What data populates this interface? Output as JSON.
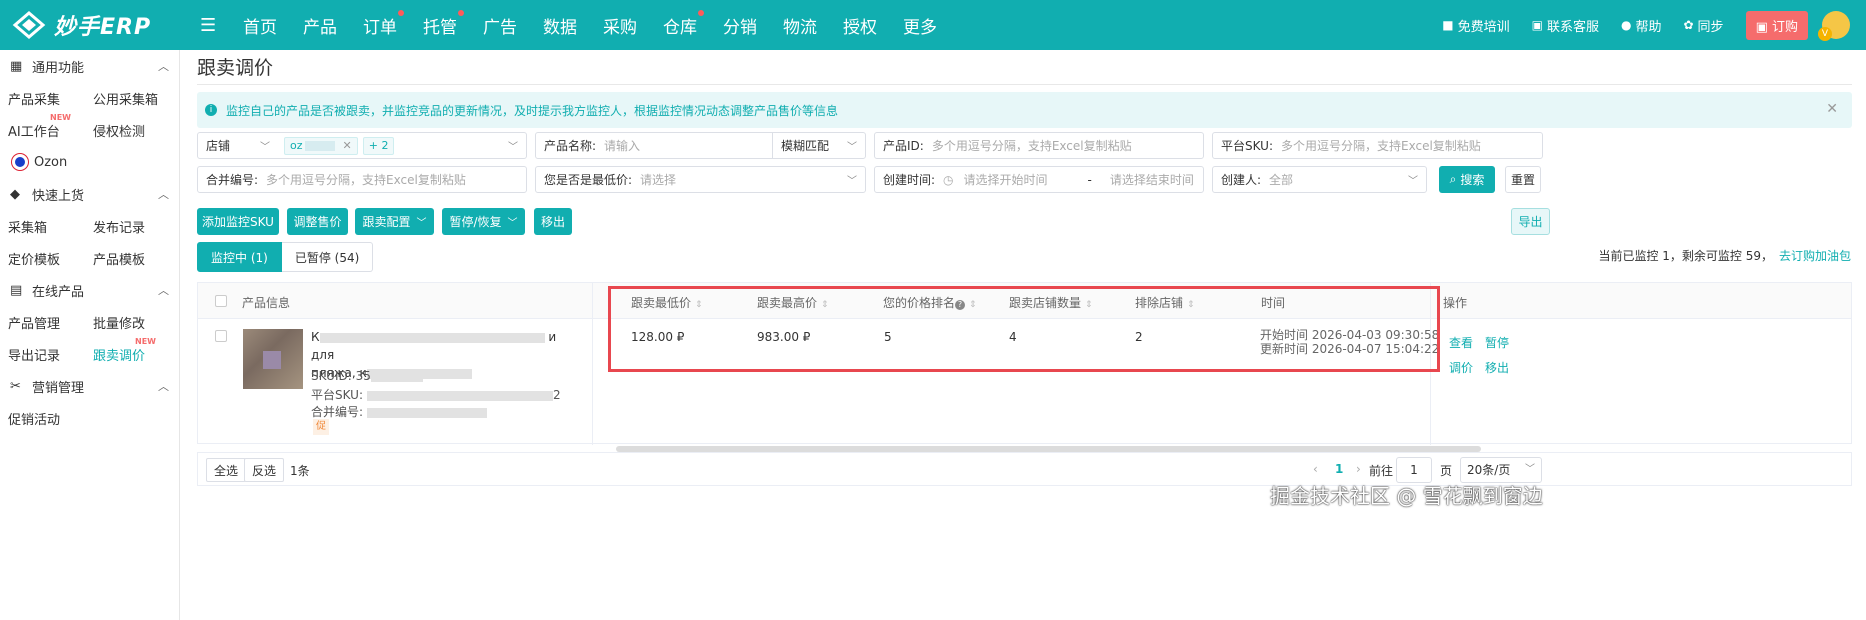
{
  "app": {
    "name": "妙手ERP"
  },
  "topnav": {
    "items": [
      {
        "label": "首页",
        "dot": false
      },
      {
        "label": "产品",
        "dot": false
      },
      {
        "label": "订单",
        "dot": true
      },
      {
        "label": "托管",
        "dot": true
      },
      {
        "label": "广告",
        "dot": false
      },
      {
        "label": "数据",
        "dot": false
      },
      {
        "label": "采购",
        "dot": false
      },
      {
        "label": "仓库",
        "dot": true
      },
      {
        "label": "分销",
        "dot": false
      },
      {
        "label": "物流",
        "dot": false
      },
      {
        "label": "授权",
        "dot": false
      },
      {
        "label": "更多",
        "dot": false
      }
    ],
    "training": "免费培训",
    "support": "联系客服",
    "help": "帮助",
    "sync": "同步",
    "order_btn": "订购"
  },
  "sidebar": {
    "general": "通用功能",
    "collect": "产品采集",
    "public_box": "公用采集箱",
    "ai": "AI工作台",
    "ai_badge": "NEW",
    "infringe": "侵权检测",
    "ozon": "Ozon",
    "quick": "快速上货",
    "collect_box": "采集箱",
    "publish_log": "发布记录",
    "price_tpl": "定价模板",
    "product_tpl": "产品模板",
    "online": "在线产品",
    "product_mgmt": "产品管理",
    "batch_edit": "批量修改",
    "export_log": "导出记录",
    "follow_price": "跟卖调价",
    "follow_badge": "NEW",
    "marketing": "营销管理",
    "promotion": "促销活动"
  },
  "page": {
    "title": "跟卖调价",
    "notice": "监控自己的产品是否被跟卖，并监控竞品的更新情况，及时提示我方监控人，根据监控情况动态调整产品售价等信息"
  },
  "filters": {
    "store_label": "店铺",
    "store_tag": "oz",
    "store_more": "+ 2",
    "pname_label": "产品名称:",
    "pname_ph": "请输入",
    "match_mode": "模糊匹配",
    "pid_label": "产品ID:",
    "pid_ph": "多个用逗号分隔，支持Excel复制粘贴",
    "sku_label": "平台SKU:",
    "sku_ph": "多个用逗号分隔，支持Excel复制粘贴",
    "merge_label": "合并编号:",
    "merge_ph": "多个用逗号分隔，支持Excel复制粘贴",
    "lowest_label": "您是否是最低价:",
    "lowest_ph": "请选择",
    "ctime_label": "创建时间:",
    "ctime_start": "请选择开始时间",
    "ctime_sep": "-",
    "ctime_end": "请选择结束时间",
    "creator_label": "创建人:",
    "creator_val": "全部",
    "search": "搜索",
    "reset": "重置"
  },
  "actions": {
    "add": "添加监控SKU",
    "adjust": "调整售价",
    "config": "跟卖配置",
    "pause": "暂停/恢复",
    "remove": "移出",
    "export": "导出"
  },
  "tabs": {
    "active": "监控中 (1)",
    "paused": "已暂停 (54)"
  },
  "monitor": {
    "text": "当前已监控 1，剩余可监控 59，",
    "link": "去订购加油包"
  },
  "table": {
    "headers": {
      "product": "产品信息",
      "min_price": "跟卖最低价",
      "max_price": "跟卖最高价",
      "rank": "您的价格排名",
      "store_count": "跟卖店铺数量",
      "exclude": "排除店铺",
      "time": "时间",
      "ops": "操作"
    },
    "row": {
      "name_start": "К",
      "name_end": "и для",
      "name_line2": "пляжа, к",
      "skuid_label": "SKUID:",
      "skuid_val": "35",
      "sku_label": "平台SKU:",
      "sku_tail": "2",
      "merge_label": "合并编号:",
      "promo": "促",
      "min_price": "128.00 ₽",
      "max_price": "983.00 ₽",
      "rank": "5",
      "store_count": "4",
      "exclude": "2",
      "start_time": "开始时间 2026-04-03 09:30:58",
      "update_time": "更新时间 2026-04-07 15:04:22",
      "op_view": "查看",
      "op_pause": "暂停",
      "op_adjust": "调价",
      "op_remove": "移出"
    }
  },
  "footer": {
    "select_all": "全选",
    "invert": "反选",
    "count": "1条",
    "page": "1",
    "goto": "前往",
    "page_input": "1",
    "page_unit": "页",
    "page_size": "20条/页"
  },
  "watermark": "掘金技术社区 @ 雪花飘到窗边"
}
